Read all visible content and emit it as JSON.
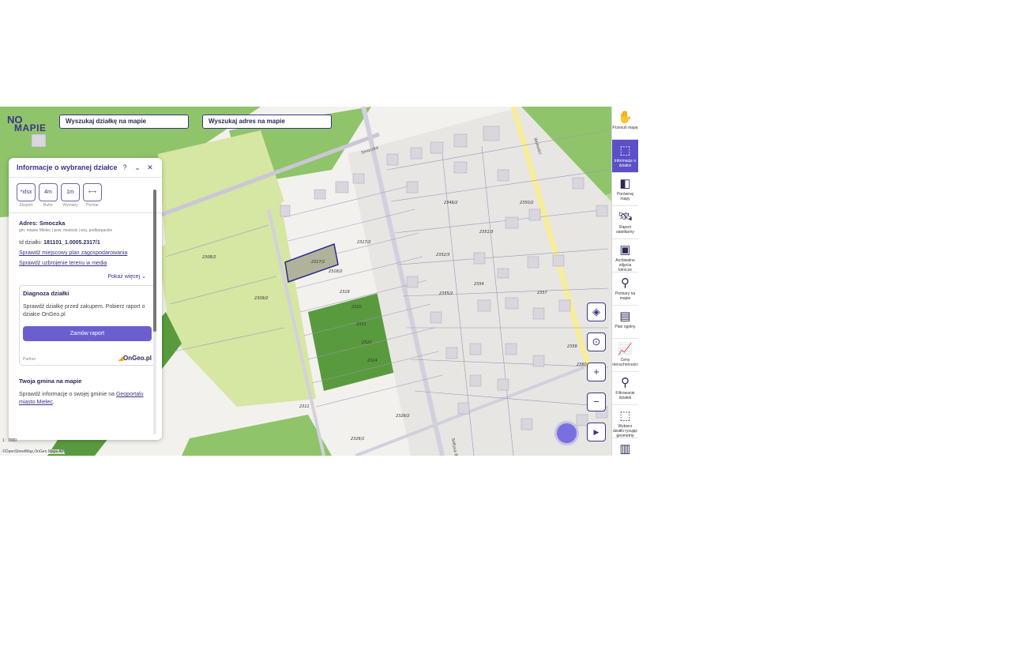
{
  "logo": {
    "line1": "NO",
    "line2": "MAPIE"
  },
  "search": {
    "parcel_placeholder": "Wyszukaj działkę na mapie",
    "address_placeholder": "Wyszukaj adres na mapie"
  },
  "panel": {
    "title": "Informacje o wybranej działce",
    "icons": [
      "help-icon",
      "chevron-down-icon",
      "close-icon"
    ],
    "tools": [
      {
        "glyph": "*xlsx",
        "label": "Eksport"
      },
      {
        "glyph": "4m",
        "label": "Bufor"
      },
      {
        "glyph": "1m",
        "label": "Wymiary"
      },
      {
        "glyph": "⟷",
        "label": "Pomiar"
      }
    ],
    "address_title": "Adres: Smoczka",
    "address_sub": "gm. miasto Mielec | pow. mielecki | woj. podkarpackie",
    "id_label": "Id działki:",
    "id_value": "181101_1.0005.2317/1",
    "link_plan": "Sprawdź miejscowy plan zagospodarowania",
    "link_media": "Sprawdź uzbrojenie terenu w media",
    "more": "Pokaż więcej",
    "diag_title": "Diagnoza działki",
    "diag_text": "Sprawdź działkę przed zakupem. Pobierz raport o działce OnGeo.pl",
    "order_button": "Zamów raport",
    "partner": "Partner",
    "ongeo_brand": "OnGeo.pl",
    "gmina_title": "Twoja gmina na mapie",
    "gmina_text": "Sprawdź informacje o swojej gminie na",
    "gmina_link": "Geoportalu miasto Mielec",
    "gmina_end": "."
  },
  "map": {
    "scale": "1 : 1000",
    "attribution": "©OpenStreetMap,OnGeo Maps API",
    "parcel_labels": [
      "2317/1",
      "2317/2",
      "2318/2",
      "2319",
      "2320",
      "2321",
      "2322",
      "2324",
      "2308/2",
      "2309/2",
      "2311",
      "2326/1",
      "2328/2",
      "2349/2",
      "2350/2",
      "2351/3",
      "2352/3",
      "2354",
      "2355/2",
      "2357",
      "2359",
      "2360"
    ],
    "street_labels": [
      "Smoczka",
      "Wolności",
      "Sołtysa Bolka"
    ]
  },
  "map_buttons": [
    "layers-icon",
    "locate-icon",
    "zoom-in-icon",
    "zoom-out-icon",
    "play-icon"
  ],
  "sidebar": [
    {
      "icon": "hand-icon",
      "glyph": "✋",
      "label": "Przesuń mapę",
      "active": false
    },
    {
      "icon": "parcel-info-icon",
      "glyph": "⬚",
      "label": "Informacje o działce",
      "active": true
    },
    {
      "icon": "compare-icon",
      "glyph": "◧",
      "label": "Porównaj mapy",
      "active": false
    },
    {
      "icon": "satellite-icon",
      "glyph": "🛰",
      "label": "Raport satelitarny",
      "active": false
    },
    {
      "icon": "photo-icon",
      "glyph": "▣",
      "label": "Archiwalne zdjęcia lotnicze",
      "active": false
    },
    {
      "icon": "measure-icon",
      "glyph": "⚲",
      "label": "Pomiary na mapie",
      "active": false
    },
    {
      "icon": "plan-icon",
      "glyph": "▤",
      "label": "Plan ogólny",
      "active": false
    },
    {
      "icon": "chart-icon",
      "glyph": "📈",
      "label": "Ceny nieruchomości",
      "active": false
    },
    {
      "icon": "filter-icon",
      "glyph": "⚲",
      "label": "Filtrowanie działek",
      "active": false
    },
    {
      "icon": "select-icon",
      "glyph": "⬚",
      "label": "Wybierz działki rysując geometrię",
      "active": false
    },
    {
      "icon": "map-icon",
      "glyph": "▥",
      "label": "",
      "active": false
    }
  ]
}
